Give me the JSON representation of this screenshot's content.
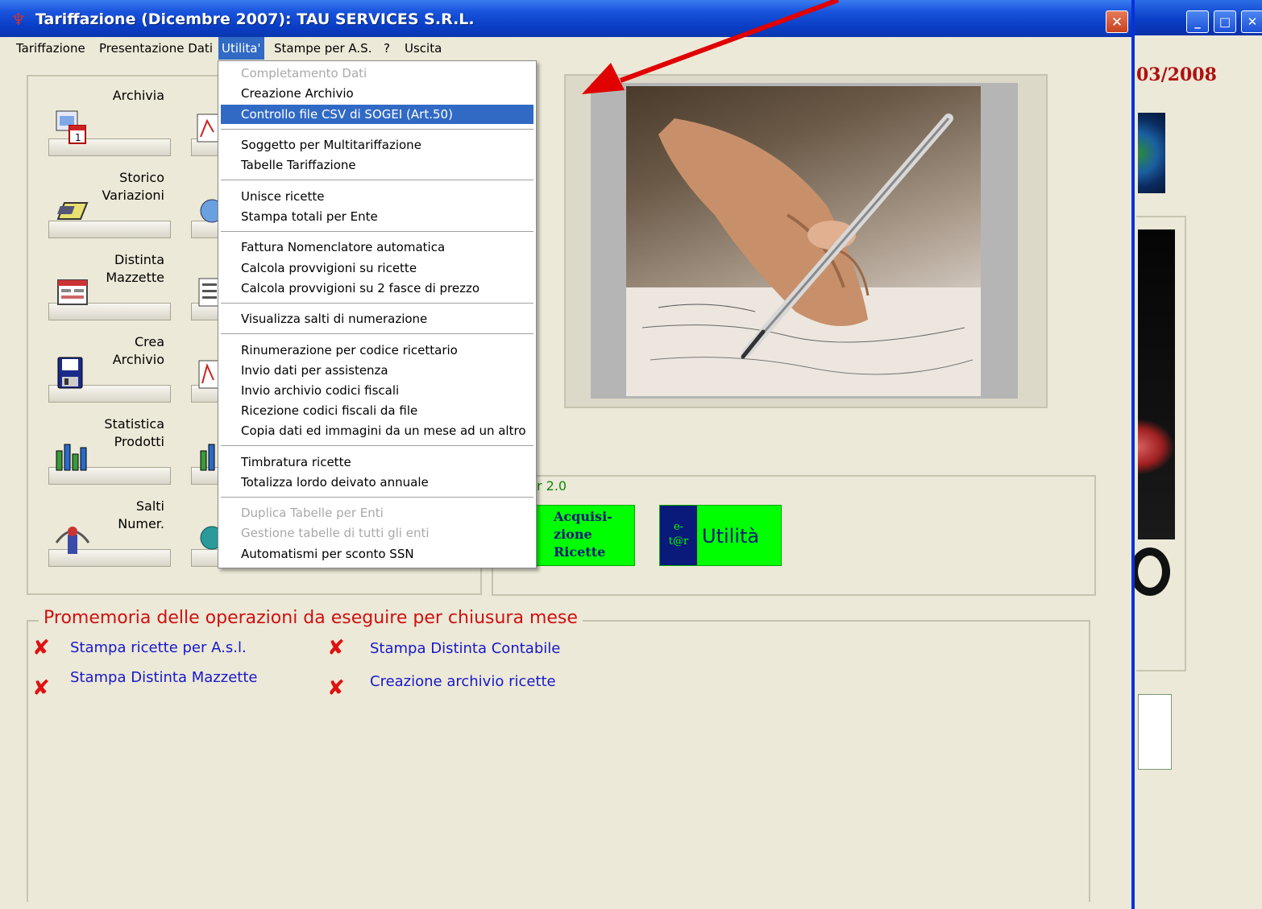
{
  "window": {
    "title": "Tariffazione (Dicembre 2007): TAU SERVICES S.R.L.",
    "close_glyph": "✕"
  },
  "background_window": {
    "date_fragment": "03/2008",
    "buttons": [
      "_",
      "□",
      "✕"
    ]
  },
  "menubar": {
    "items": [
      "Tariffazione",
      "Presentazione Dati",
      "Utilita'",
      "Stampe per A.S.",
      "?",
      "Uscita"
    ],
    "active_index": 2
  },
  "tools": {
    "left": [
      {
        "label": "Archivia",
        "icon": "calendar-icon"
      },
      {
        "label": "Storico\nVariazioni",
        "icon": "card-icon"
      },
      {
        "label": "Distinta\nMazzette",
        "icon": "form-icon"
      },
      {
        "label": "Crea\nArchivio",
        "icon": "floppy-icon"
      },
      {
        "label": "Statistica\nProdotti",
        "icon": "bar-chart-icon"
      },
      {
        "label": "Salti\nNumer.",
        "icon": "jump-icon"
      }
    ]
  },
  "dropdown": {
    "items": [
      {
        "label": "Completamento Dati",
        "disabled": true
      },
      {
        "label": "Creazione Archivio"
      },
      {
        "label": "Controllo file CSV di SOGEI (Art.50)",
        "highlighted": true
      },
      {
        "label": "Soggetto per Multitariffazione"
      },
      {
        "label": "Tabelle Tariffazione"
      },
      {
        "label": "Unisce ricette"
      },
      {
        "label": "Stampa totali per Ente"
      },
      {
        "label": "Fattura Nomenclatore automatica"
      },
      {
        "label": "Calcola provvigioni su ricette"
      },
      {
        "label": "Calcola provvigioni su 2 fasce di prezzo"
      },
      {
        "label": "Visualizza salti di numerazione"
      },
      {
        "label": "Rinumerazione per codice ricettario"
      },
      {
        "label": "Invio dati per assistenza"
      },
      {
        "label": "Invio archivio codici fiscali"
      },
      {
        "label": "Ricezione codici fiscali da file"
      },
      {
        "label": "Copia dati ed immagini da un mese ad un altro"
      },
      {
        "label": "Timbratura ricette"
      },
      {
        "label": "Totalizza lordo deivato annuale"
      },
      {
        "label": "Duplica Tabelle per Enti",
        "disabled": true
      },
      {
        "label": "Gestione tabelle di tutti gli enti",
        "disabled": true
      },
      {
        "label": "Automatismi per sconto SSN"
      }
    ]
  },
  "version_panel": {
    "version_text": "r 2.0",
    "btn1": {
      "side": "r",
      "label_lines": [
        "Acquisi-",
        "zione",
        "Ricette"
      ]
    },
    "btn2": {
      "side_top": "e-",
      "side_bottom": "t@r",
      "label": "Utilità"
    }
  },
  "promemoria": {
    "title": "Promemoria delle operazioni da eseguire per chiusura mese",
    "tasks": [
      {
        "label": "Stampa ricette per A.s.l.",
        "status": "x-icon"
      },
      {
        "label": "Stampa Distinta Contabile",
        "status": "x-icon"
      },
      {
        "label": "Stampa Distinta Mazzette",
        "status": "x-icon"
      },
      {
        "label": "Creazione archivio ricette",
        "status": "x-icon"
      }
    ],
    "x_glyph": "✘"
  },
  "colors": {
    "title_bar": "#0A3EC6",
    "menu_highlight": "#316AC5",
    "promo_title": "#D01010",
    "task_link": "#1818C8",
    "green_button": "#00FF00",
    "annotation_arrow": "#E00000"
  }
}
